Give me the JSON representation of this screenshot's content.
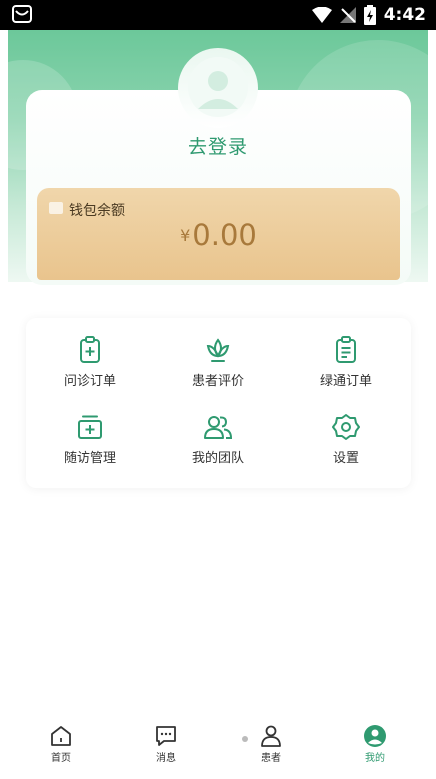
{
  "status_bar": {
    "time": "4:42"
  },
  "profile": {
    "login_label": "去登录"
  },
  "wallet": {
    "title": "钱包余额",
    "currency": "¥",
    "balance": "0.00"
  },
  "menu": [
    {
      "label": "问诊订单",
      "icon": "clipboard-plus-icon"
    },
    {
      "label": "患者评价",
      "icon": "lotus-icon"
    },
    {
      "label": "绿通订单",
      "icon": "clipboard-list-icon"
    },
    {
      "label": "随访管理",
      "icon": "medkit-icon"
    },
    {
      "label": "我的团队",
      "icon": "team-icon"
    },
    {
      "label": "设置",
      "icon": "settings-icon"
    }
  ],
  "nav": [
    {
      "label": "首页",
      "icon": "home-icon",
      "active": false
    },
    {
      "label": "消息",
      "icon": "message-icon",
      "active": false
    },
    {
      "label": "患者",
      "icon": "patient-icon",
      "active": false
    },
    {
      "label": "我的",
      "icon": "profile-icon",
      "active": true
    }
  ],
  "colors": {
    "accent": "#2f9a70",
    "hero": "#6cc89a",
    "wallet": "#e9c48d",
    "wallet_text": "#a8793b"
  }
}
